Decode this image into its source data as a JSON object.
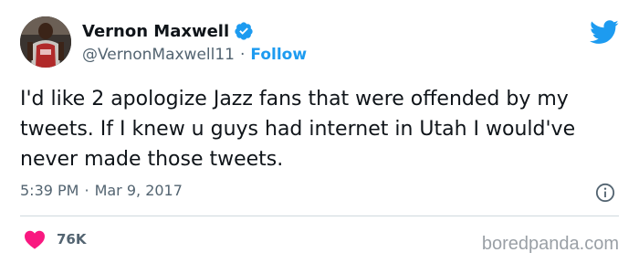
{
  "author": {
    "display_name": "Vernon Maxwell",
    "handle": "@VernonMaxwell11",
    "separator": "·",
    "follow_label": "Follow",
    "verified": true,
    "avatar_icon": "player-avatar-icon"
  },
  "tweet": {
    "text": "I'd like 2 apologize Jazz fans that were offended by my tweets. If I knew u guys had internet in Utah I would've never made those tweets.",
    "time": "5:39 PM",
    "date_separator": "·",
    "date": "Mar 9, 2017"
  },
  "engagement": {
    "likes": "76K"
  },
  "watermark": "boredpanda.com",
  "colors": {
    "accent": "#1d9bf0",
    "heart": "#f91880",
    "text": "#0f1419",
    "muted": "#536471"
  },
  "icons": {
    "brand": "twitter-bird-icon",
    "verified": "verified-badge-icon",
    "info": "info-icon",
    "like": "heart-icon"
  }
}
